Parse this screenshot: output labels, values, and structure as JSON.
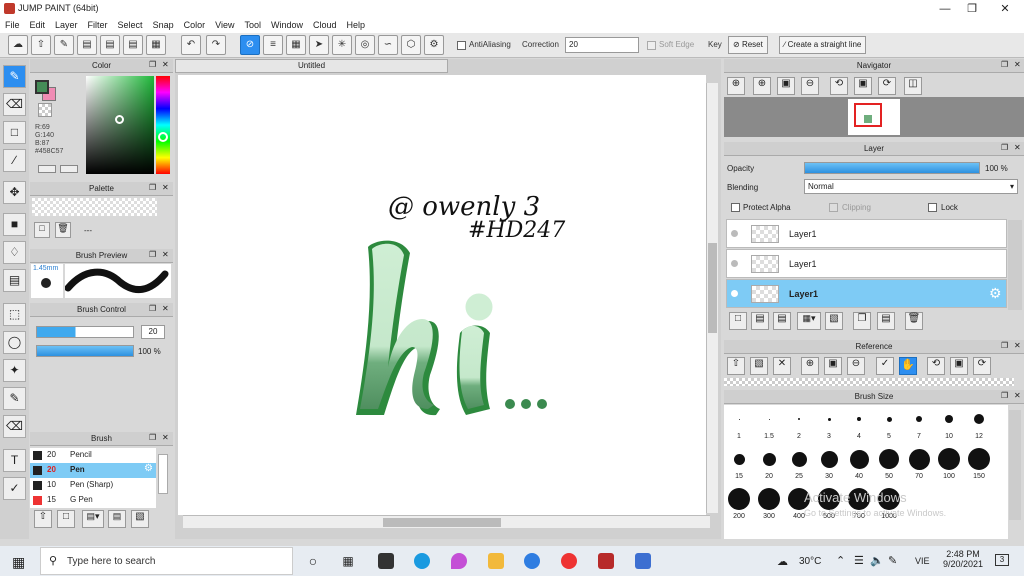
{
  "window": {
    "title": "JUMP PAINT (64bit)"
  },
  "menu": [
    "File",
    "Edit",
    "Layer",
    "Filter",
    "Select",
    "Snap",
    "Color",
    "View",
    "Tool",
    "Window",
    "Cloud",
    "Help"
  ],
  "toolbar": {
    "antialiasing": "AntiAliasing",
    "correction_label": "Correction",
    "correction_value": "20",
    "soft_edge": "Soft Edge",
    "key": "Key",
    "reset": "Reset",
    "straight_line": "Create a straight line"
  },
  "color_panel": {
    "title": "Color",
    "r": "R:69",
    "g": "G:140",
    "b": "B:87",
    "hex": "#458C57",
    "fg": "#458c57",
    "bg": "#f08cb4"
  },
  "palette": {
    "title": "Palette",
    "value": "---"
  },
  "brush_preview": {
    "title": "Brush Preview",
    "size": "1.45mm"
  },
  "brush_control": {
    "title": "Brush Control",
    "size": "20",
    "opacity": "100 %"
  },
  "brush": {
    "title": "Brush",
    "items": [
      {
        "size": "20",
        "name": "Pencil"
      },
      {
        "size": "20",
        "name": "Pen"
      },
      {
        "size": "10",
        "name": "Pen (Sharp)"
      },
      {
        "size": "15",
        "name": "G Pen"
      }
    ]
  },
  "canvas": {
    "tab": "Untitled",
    "handle": "@ owenly 3",
    "tag": "#HD247",
    "word": "hi",
    "dots": "•••"
  },
  "navigator": {
    "title": "Navigator"
  },
  "layer": {
    "title": "Layer",
    "opacity_label": "Opacity",
    "opacity_value": "100 %",
    "blending_label": "Blending",
    "blending_value": "Normal",
    "protect_alpha": "Protect Alpha",
    "clipping": "Clipping",
    "lock": "Lock",
    "rows": [
      "Layer1",
      "Layer1",
      "Layer1"
    ]
  },
  "reference": {
    "title": "Reference"
  },
  "brush_size": {
    "title": "Brush Size",
    "row1": [
      "1",
      "1.5",
      "2",
      "3",
      "4",
      "5",
      "7",
      "10",
      "12"
    ],
    "row2": [
      "15",
      "20",
      "25",
      "30",
      "40",
      "50",
      "70",
      "100",
      "150"
    ],
    "row3": [
      "200",
      "300",
      "400",
      "500",
      "700",
      "1000"
    ],
    "watermark1": "Activate Windows",
    "watermark2": "Go to Settings to activate Windows."
  },
  "taskbar": {
    "search": "Type here to search",
    "temp": "30°C",
    "lang": "VIE",
    "time": "2:48 PM",
    "date": "9/20/2021",
    "notif": "3"
  }
}
